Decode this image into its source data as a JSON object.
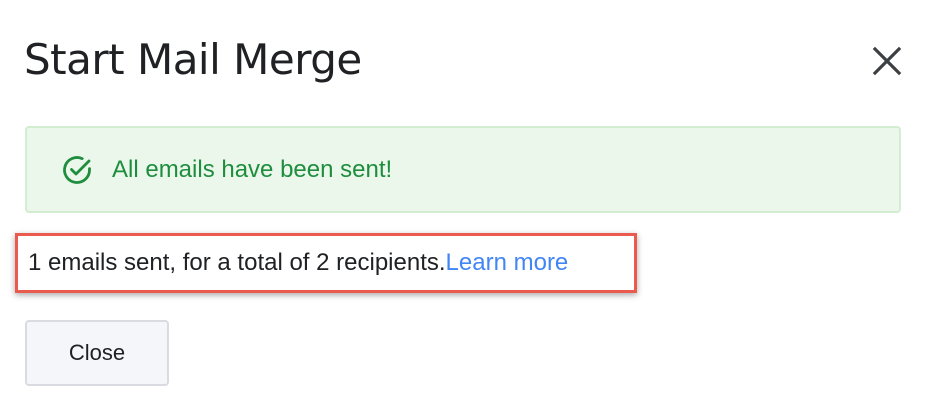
{
  "dialog": {
    "title": "Start Mail Merge",
    "close_icon": "close-icon"
  },
  "banner": {
    "icon": "check-circle-icon",
    "message": "All emails have been sent!",
    "accent_color": "#1e8e3e",
    "background_color": "#ecf7ec"
  },
  "summary": {
    "text": "1 emails sent, for a total of 2 recipients.",
    "link_label": "Learn more",
    "link_color": "#4285f4",
    "highlight_color": "#ea5a4e"
  },
  "footer": {
    "close_label": "Close"
  }
}
